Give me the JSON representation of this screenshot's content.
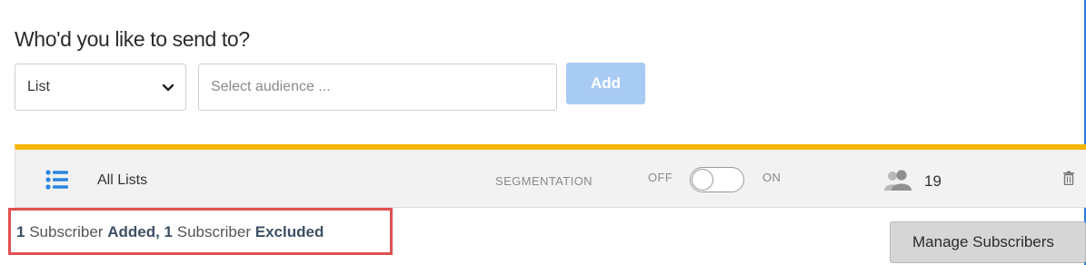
{
  "section_title": "Who'd you like to send to?",
  "audience_type": {
    "selected": "List",
    "icon": "chevron-down-icon"
  },
  "audience_input": {
    "value": "",
    "placeholder": "Select audience ..."
  },
  "add_button": {
    "label": "Add",
    "color": "#a8cbf3"
  },
  "list_row": {
    "icon": "list-icon",
    "name": "All Lists",
    "segmentation_label": "SEGMENTATION",
    "toggle": {
      "off_label": "OFF",
      "on_label": "ON",
      "state": "off"
    },
    "subscriber_icon": "people-icon",
    "subscriber_count": "19",
    "delete_icon": "trash-icon",
    "accent_color": "#f7b500"
  },
  "summary": {
    "added_count": "1",
    "added_noun": "Subscriber",
    "added_word": "Added,",
    "excluded_count": "1",
    "excluded_noun": "Subscriber",
    "excluded_word": "Excluded",
    "highlight_color": "#e25050"
  },
  "manage_button": {
    "label": "Manage Subscribers"
  }
}
